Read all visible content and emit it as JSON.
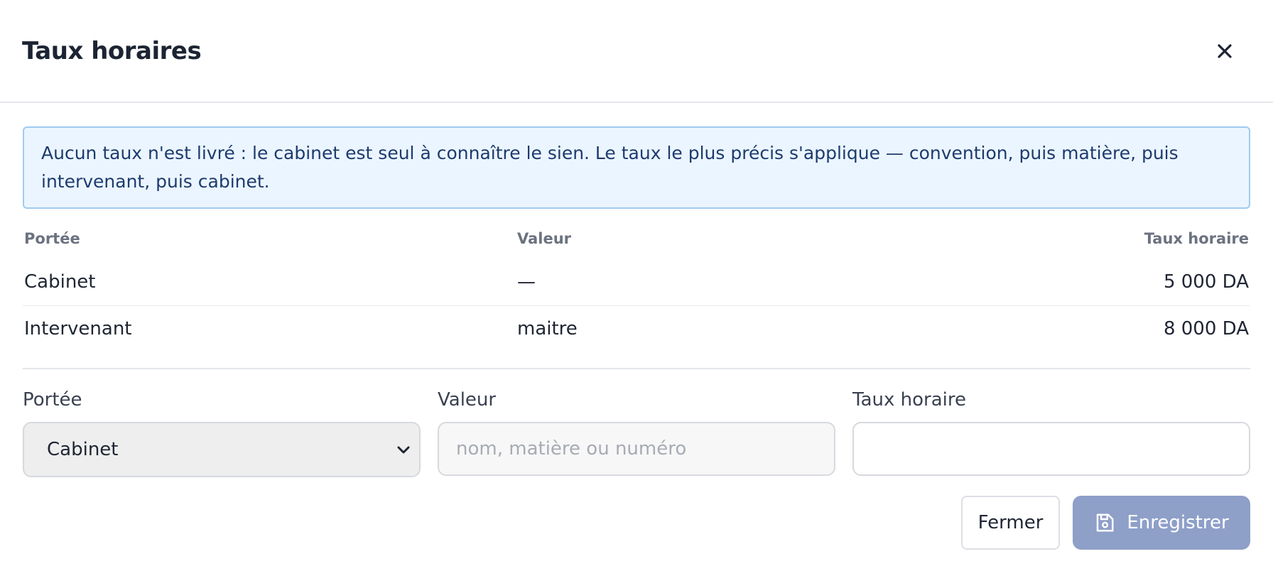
{
  "modal": {
    "title": "Taux horaires",
    "close_icon": "close-icon"
  },
  "notice": {
    "text": "Aucun taux n'est livré : le cabinet est seul à connaître le sien. Le taux le plus précis s'applique — convention, puis matière, puis intervenant, puis cabinet."
  },
  "table": {
    "headers": {
      "scope": "Portée",
      "value": "Valeur",
      "rate": "Taux horaire"
    },
    "rows": [
      {
        "scope": "Cabinet",
        "value": "—",
        "rate": "5 000 DA"
      },
      {
        "scope": "Intervenant",
        "value": "maitre",
        "rate": "8 000 DA"
      }
    ]
  },
  "form": {
    "scope": {
      "label": "Portée",
      "selected": "Cabinet"
    },
    "value": {
      "label": "Valeur",
      "placeholder": "nom, matière ou numéro",
      "current": ""
    },
    "rate": {
      "label": "Taux horaire",
      "placeholder": "",
      "current": ""
    }
  },
  "actions": {
    "close_label": "Fermer",
    "save_label": "Enregistrer",
    "save_icon": "floppy-disk-icon"
  },
  "colors": {
    "notice_background": "#ebf5ff",
    "notice_border": "#9fcbf2",
    "save_button": "#8e9fc8"
  }
}
